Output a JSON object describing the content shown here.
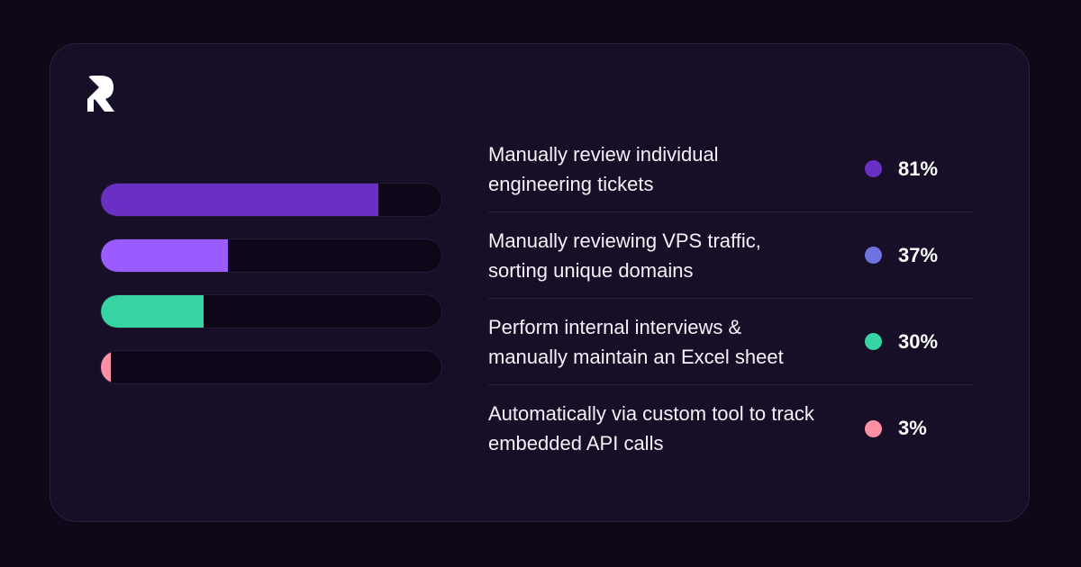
{
  "brand": {
    "logo_icon": "r-logo-icon",
    "logo_color": "#ffffff"
  },
  "colors": {
    "page_background": "#0e0819",
    "card_background": "#170e28",
    "track_background": "#0d0719"
  },
  "chart_data": {
    "type": "bar",
    "orientation": "horizontal",
    "categories": [
      "Manually review individual engineering tickets",
      "Manually reviewing VPS traffic, sorting unique domains",
      "Perform internal interviews & manually maintain an Excel sheet",
      "Automatically via custom tool to track embedded API calls"
    ],
    "values": [
      81,
      37,
      30,
      3
    ],
    "value_labels": [
      "81%",
      "37%",
      "30%",
      "3%"
    ],
    "unit": "%",
    "xlim": [
      0,
      100
    ],
    "bar_colors": [
      "#6930c3",
      "#9b5cff",
      "#36d3a3",
      "#ff8fa3"
    ],
    "dot_colors": [
      "#6930c3",
      "#6f73e0",
      "#36d3a3",
      "#ff8fa3"
    ],
    "legend_placement": "right",
    "grid": false
  }
}
